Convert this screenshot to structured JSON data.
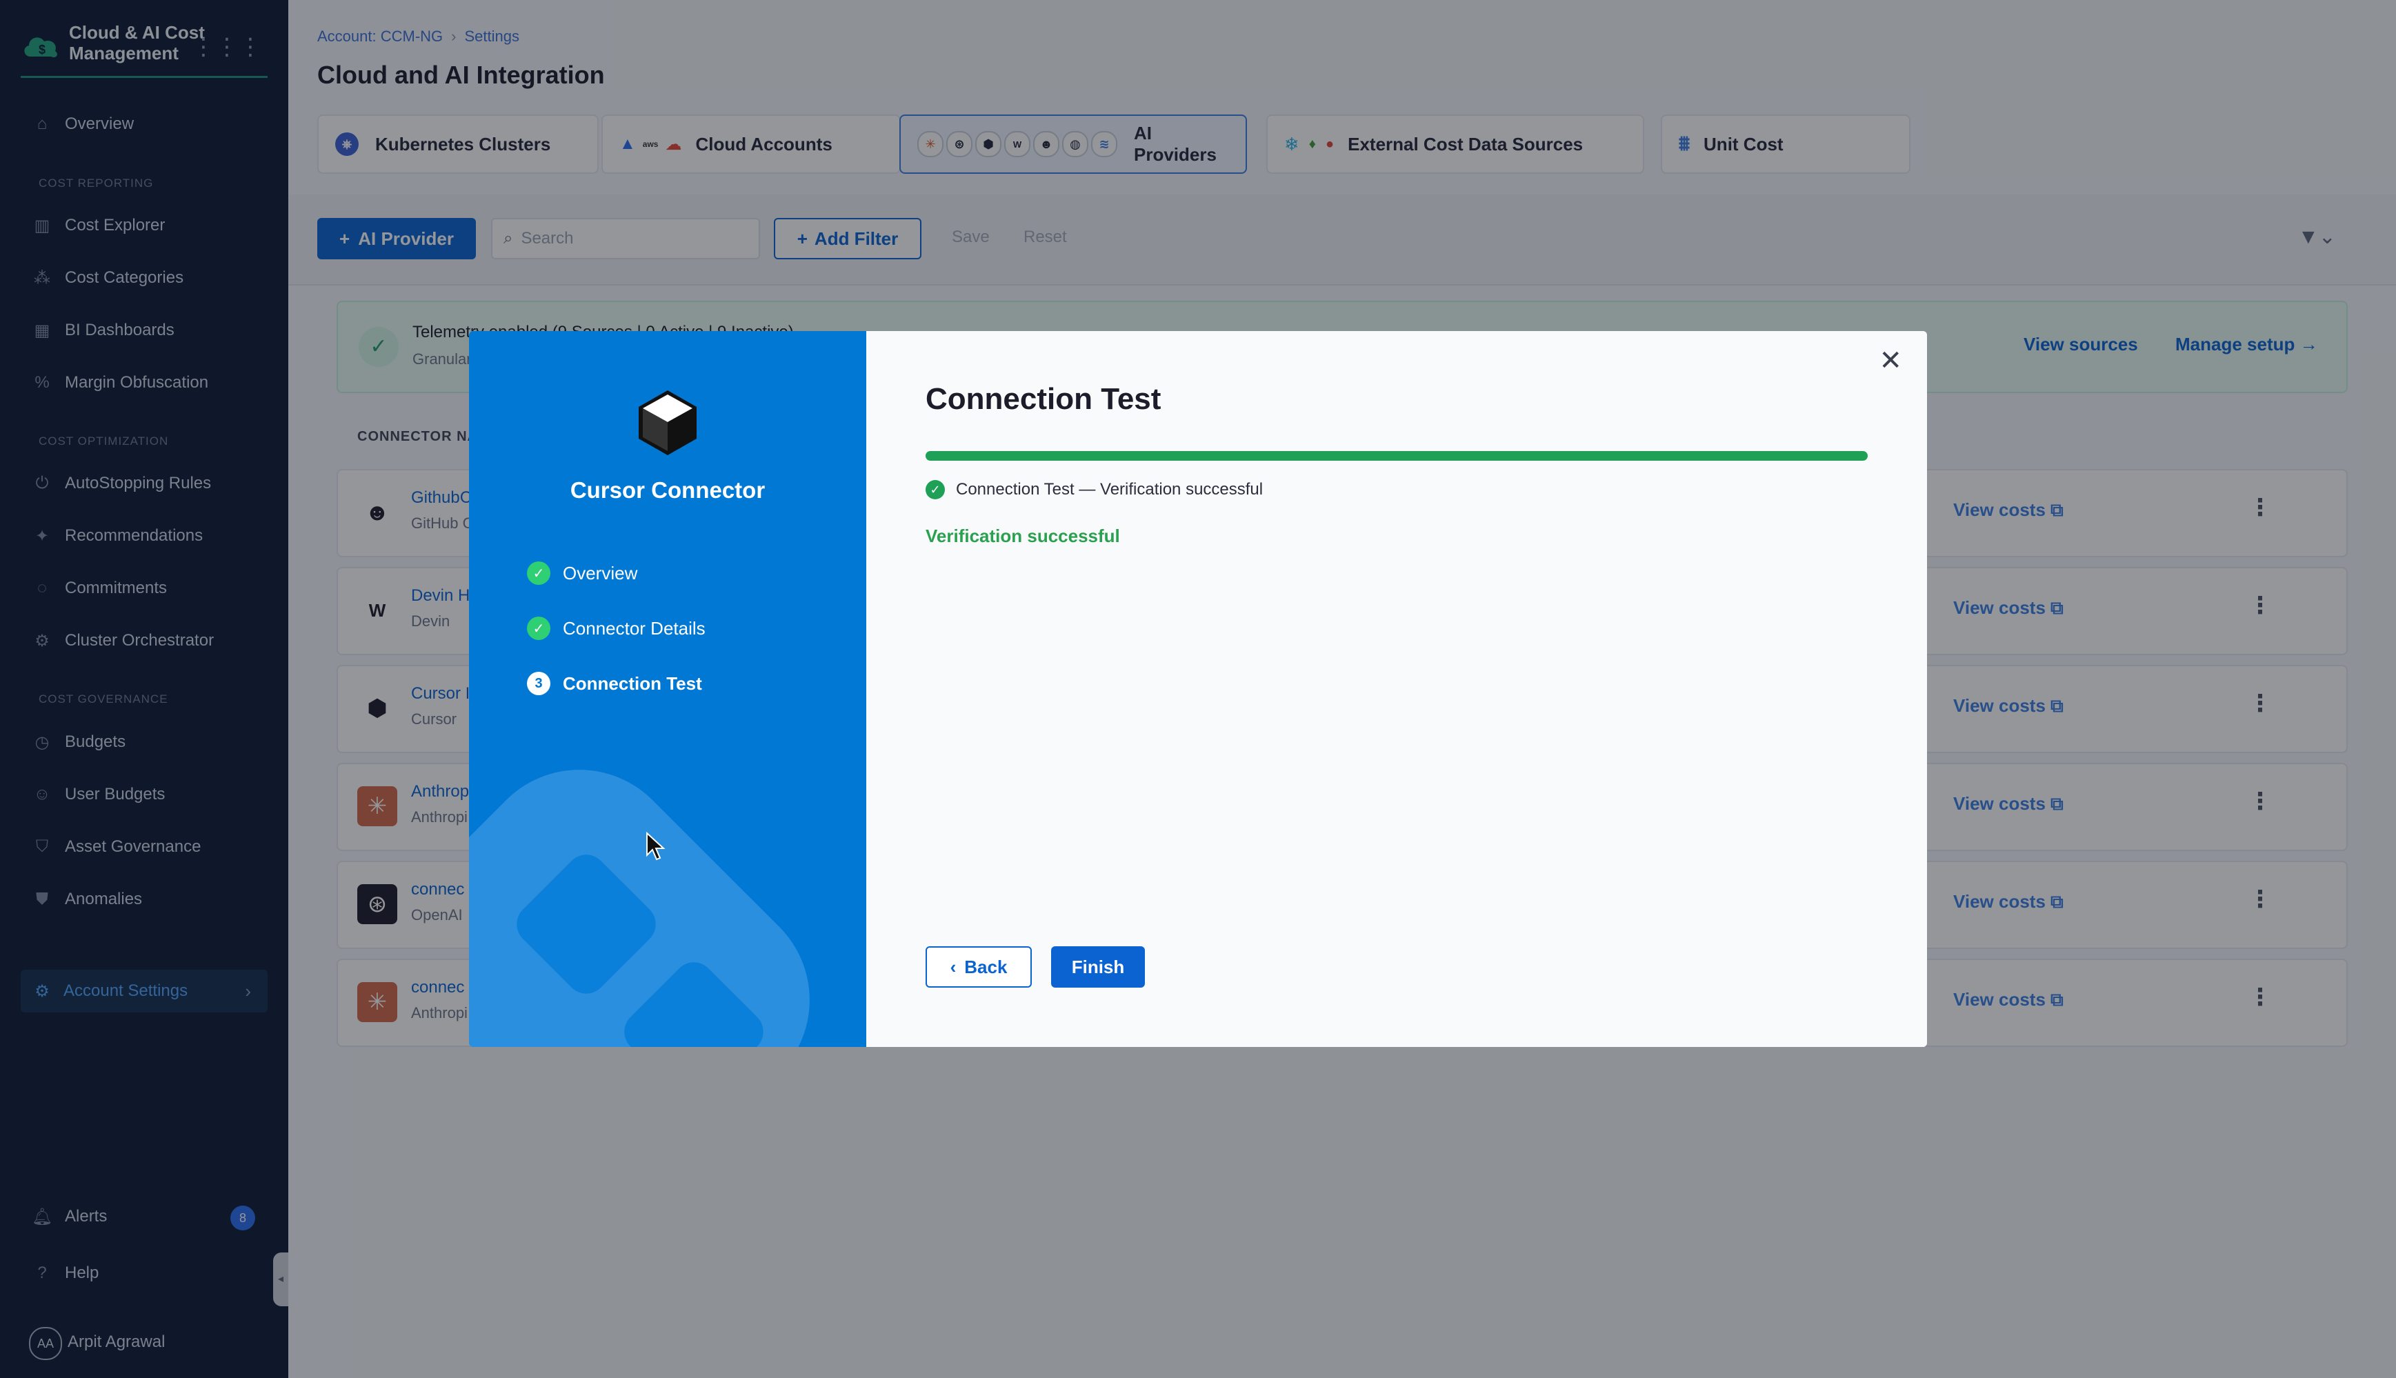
{
  "sidebar": {
    "app_name": "Cloud & AI Cost Management",
    "items": [
      {
        "label": "Overview",
        "icon": "home-icon"
      },
      {
        "label": "Cost Explorer",
        "icon": "chart-icon"
      },
      {
        "label": "Cost Categories",
        "icon": "categories-icon"
      },
      {
        "label": "BI Dashboards",
        "icon": "dashboard-icon"
      },
      {
        "label": "Margin Obfuscation",
        "icon": "percent-icon"
      },
      {
        "label": "AutoStopping Rules",
        "icon": "autostop-icon"
      },
      {
        "label": "Recommendations",
        "icon": "recommend-icon"
      },
      {
        "label": "Commitments",
        "icon": "commitment-icon"
      },
      {
        "label": "Cluster Orchestrator",
        "icon": "cluster-icon"
      },
      {
        "label": "Budgets",
        "icon": "budget-icon"
      },
      {
        "label": "User Budgets",
        "icon": "user-icon"
      },
      {
        "label": "Asset Governance",
        "icon": "governance-icon"
      },
      {
        "label": "Anomalies",
        "icon": "anomaly-icon"
      }
    ],
    "sections": [
      "COST REPORTING",
      "COST OPTIMIZATION",
      "COST GOVERNANCE"
    ],
    "account_settings": "Account Settings",
    "alerts": "Alerts",
    "alerts_count": "8",
    "help": "Help",
    "user_initials": "AA",
    "user_name": "Arpit Agrawal"
  },
  "header": {
    "breadcrumb": [
      "Account: CCM-NG",
      "Settings"
    ],
    "title": "Cloud and AI Integration"
  },
  "tabs": [
    {
      "label": "Kubernetes Clusters"
    },
    {
      "label": "Cloud Accounts"
    },
    {
      "label": "AI Providers",
      "active": true
    },
    {
      "label": "External Cost Data Sources"
    },
    {
      "label": "Unit Cost"
    }
  ],
  "toolbar": {
    "add_provider": "AI Provider",
    "search_placeholder": "Search",
    "add_filter": "Add Filter",
    "save": "Save",
    "reset": "Reset"
  },
  "banner": {
    "title": "Telemetry enabled (9 Sources | 0 Active | 9 Inactive)",
    "subtitle": "Granular",
    "view_sources": "View sources",
    "manage_setup": "Manage setup"
  },
  "table": {
    "column_header": "CONNECTOR NA",
    "view_costs": "View costs",
    "rows": [
      {
        "name": "GithubC",
        "provider": "GitHub C",
        "icon": "github-icon"
      },
      {
        "name": "Devin H",
        "provider": "Devin",
        "icon": "devin-icon"
      },
      {
        "name": "Cursor I",
        "provider": "Cursor",
        "icon": "cursor-icon"
      },
      {
        "name": "Anthrop",
        "provider": "Anthropi",
        "icon": "anthropic-icon"
      },
      {
        "name": "connec",
        "provider": "OpenAI",
        "icon": "openai-icon"
      },
      {
        "name": "connec",
        "provider": "Anthropi",
        "icon": "anthropic-icon"
      }
    ]
  },
  "modal": {
    "connector_name": "Cursor Connector",
    "steps": [
      {
        "label": "Overview",
        "state": "done"
      },
      {
        "label": "Connector Details",
        "state": "done"
      },
      {
        "label": "Connection Test",
        "state": "current",
        "number": "3"
      }
    ],
    "title": "Connection Test",
    "progress": 1.0,
    "status_text": "Connection Test — Verification successful",
    "verification_text": "Verification successful",
    "back": "Back",
    "finish": "Finish"
  },
  "colors": {
    "primary": "#0a63d1",
    "sidebar_bg": "#0b1a33",
    "modal_left": "#0278d5",
    "success": "#1ea056"
  }
}
